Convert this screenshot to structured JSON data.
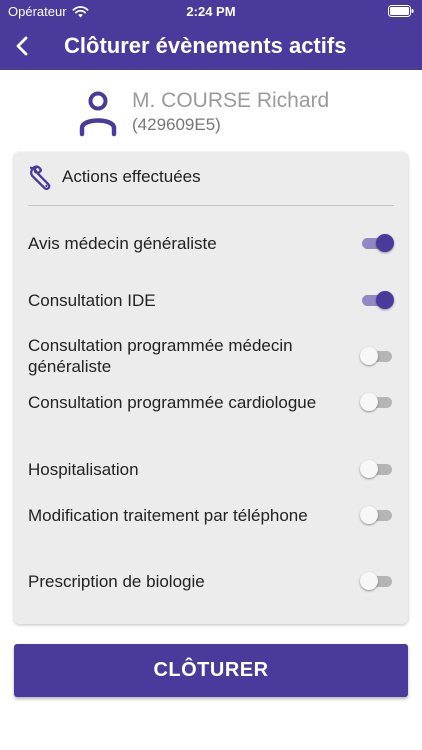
{
  "status_bar": {
    "carrier": "Opérateur",
    "time": "2:24 PM"
  },
  "header": {
    "title": "Clôturer évènements actifs",
    "back_icon": "chevron-left-icon"
  },
  "patient": {
    "name": "M. COURSE Richard",
    "id": "(429609E5)",
    "icon": "person-icon"
  },
  "card": {
    "title": "Actions effectuées",
    "icon": "wrench-icon",
    "items": [
      {
        "label": "Avis médecin généraliste",
        "on": true
      },
      {
        "label": "Consultation IDE",
        "on": true
      },
      {
        "label": "Consultation programmée médecin généraliste",
        "on": false
      },
      {
        "label": "Consultation programmée cardiologue",
        "on": false
      },
      {
        "label": "Hospitalisation",
        "on": false
      },
      {
        "label": "Modification traitement par téléphone",
        "on": false
      },
      {
        "label": "Prescription de biologie",
        "on": false
      }
    ]
  },
  "submit_label": "CLÔTURER",
  "colors": {
    "primary": "#4a3a9c",
    "toggle_track_on": "#9487c6",
    "card_bg": "#ececec"
  }
}
